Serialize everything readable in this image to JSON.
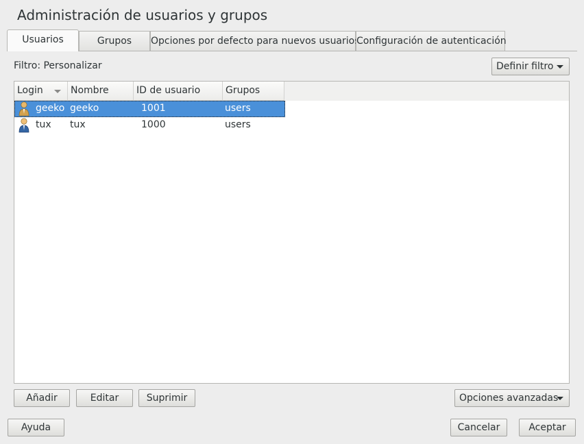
{
  "window": {
    "title": "Administración de usuarios y grupos"
  },
  "tabs": [
    {
      "label": "Usuarios",
      "underline": "U",
      "active": true
    },
    {
      "label": "Grupos",
      "underline": "G",
      "active": false
    },
    {
      "label": "Opciones por defecto para nuevos usuarios",
      "underline": "n",
      "active": false
    },
    {
      "label": "Configuración de autenticación",
      "underline": "o",
      "active": false
    }
  ],
  "filter": {
    "label": "Filtro: Personalizar",
    "button_label": "Definir filtro"
  },
  "table": {
    "columns": [
      "Login",
      "Nombre",
      "ID de usuario",
      "Grupos"
    ],
    "rows": [
      {
        "login": "geeko",
        "name": "geeko",
        "uid": "1001",
        "groups": "users",
        "selected": true
      },
      {
        "login": "tux",
        "name": "tux",
        "uid": "1000",
        "groups": "users",
        "selected": false
      }
    ]
  },
  "actions": {
    "add": "Añadir",
    "edit": "Editar",
    "delete": "Suprimir",
    "advanced": "Opciones avanzadas"
  },
  "footer": {
    "help": "Ayuda",
    "cancel": "Cancelar",
    "accept": "Aceptar"
  },
  "colors": {
    "selection": "#4a90d9",
    "background": "#ededed"
  }
}
